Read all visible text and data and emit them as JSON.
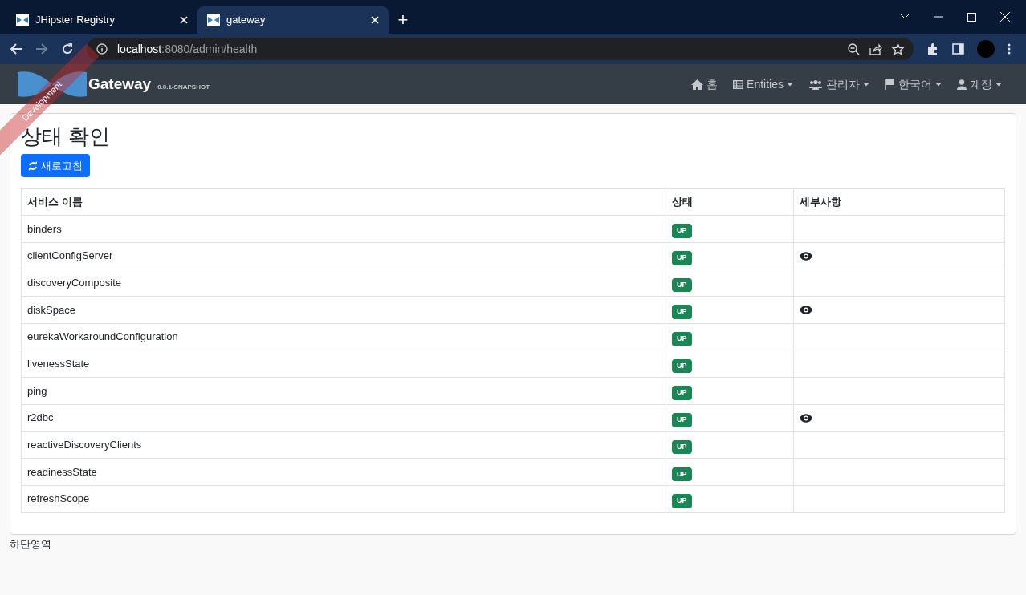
{
  "browser": {
    "tabs": [
      {
        "title": "JHipster Registry",
        "selected": false
      },
      {
        "title": "gateway",
        "selected": true
      }
    ],
    "new_tab": "+",
    "url_host": "localhost",
    "url_path": ":8080/admin/health"
  },
  "navbar": {
    "brand": "Gateway",
    "version": "0.0.1-SNAPSHOT",
    "ribbon": "Development",
    "items": [
      {
        "kind": "home",
        "label": "홈",
        "dropdown": false
      },
      {
        "kind": "table",
        "label": "Entities",
        "dropdown": true
      },
      {
        "kind": "users",
        "label": "관리자",
        "dropdown": true
      },
      {
        "kind": "flag",
        "label": "한국어",
        "dropdown": true
      },
      {
        "kind": "user",
        "label": "계정",
        "dropdown": true
      }
    ]
  },
  "page": {
    "title": "상태 확인",
    "refresh_button": "새로고침"
  },
  "table": {
    "columns": [
      "서비스 이름",
      "상태",
      "세부사항"
    ],
    "rows": [
      {
        "name": "binders",
        "status": "UP",
        "details": false
      },
      {
        "name": "clientConfigServer",
        "status": "UP",
        "details": true
      },
      {
        "name": "discoveryComposite",
        "status": "UP",
        "details": false
      },
      {
        "name": "diskSpace",
        "status": "UP",
        "details": true
      },
      {
        "name": "eurekaWorkaroundConfiguration",
        "status": "UP",
        "details": false
      },
      {
        "name": "livenessState",
        "status": "UP",
        "details": false
      },
      {
        "name": "ping",
        "status": "UP",
        "details": false
      },
      {
        "name": "r2dbc",
        "status": "UP",
        "details": true
      },
      {
        "name": "reactiveDiscoveryClients",
        "status": "UP",
        "details": false
      },
      {
        "name": "readinessState",
        "status": "UP",
        "details": false
      },
      {
        "name": "refreshScope",
        "status": "UP",
        "details": false
      }
    ]
  },
  "footer": "하단영역"
}
